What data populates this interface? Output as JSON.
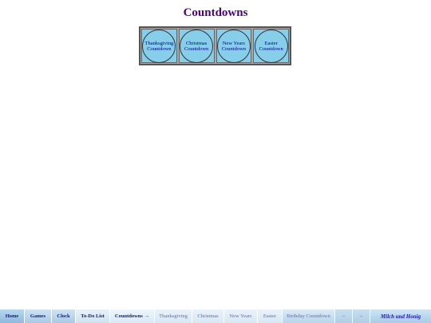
{
  "page": {
    "title": "Countdowns"
  },
  "countdowns": [
    {
      "line1": "Thanksgiving",
      "line2": "Countdown"
    },
    {
      "line1": "Christmas",
      "line2": "Countdown"
    },
    {
      "line1": "New Years",
      "line2": "Countdown"
    },
    {
      "line1": "Easter",
      "line2": "Countdown"
    }
  ],
  "nav": {
    "home": "Home",
    "games": "Games",
    "clock": "Clock",
    "todo": "To-Do List",
    "countdowns": "Countdowns →",
    "thanksgiving": "Thanksgiving",
    "christmas": "Christmas",
    "new_years": "New Years",
    "easter": "Easter",
    "birthday": "Birthday Countdown",
    "extra1": "--",
    "extra2": "--",
    "brand": "Milch und Honig"
  },
  "colors": {
    "title": "#4b0082",
    "circle_fill": "#87ceeb",
    "nav_bg": "#cfe4f5"
  }
}
